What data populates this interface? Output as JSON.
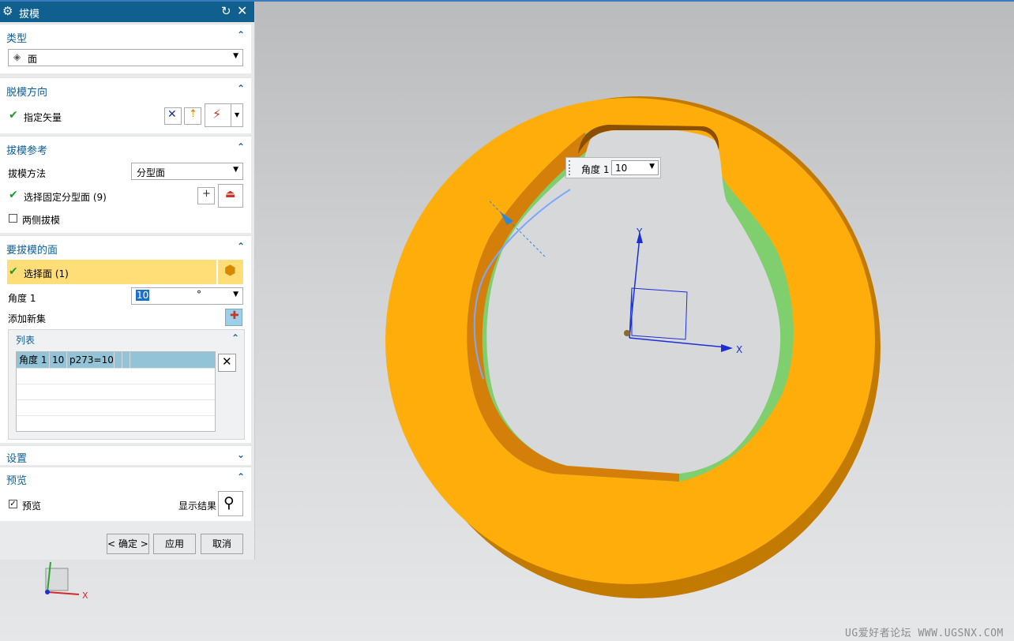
{
  "dialog": {
    "title": "拔模",
    "type_section": {
      "header": "类型",
      "type_value": "面"
    },
    "draw_direction_section": {
      "header": "脱模方向",
      "specify_vector_label": "指定矢量"
    },
    "draft_reference_section": {
      "header": "拔模参考",
      "method_label": "拔模方法",
      "method_value": "分型面",
      "select_parting_label": "选择固定分型面 (9)",
      "both_sides_label": "两侧拔模"
    },
    "faces_section": {
      "header": "要拔模的面",
      "select_face_label": "选择面 (1)",
      "angle_label": "角度 1",
      "angle_value": "10",
      "angle_unit": "°",
      "add_new_set_label": "添加新集"
    },
    "list_section": {
      "header": "列表",
      "rows": [
        {
          "name": "角度 1",
          "value": "10",
          "expr": "p273=10"
        }
      ]
    },
    "settings_section": {
      "header": "设置"
    },
    "preview_section": {
      "header": "预览",
      "preview_label": "预览",
      "show_result_label": "显示结果"
    },
    "buttons": {
      "ok": "< 确定 >",
      "apply": "应用",
      "cancel": "取消"
    }
  },
  "viewport": {
    "angle_popup": {
      "label": "角度 1",
      "value": "10"
    },
    "axis_labels": {
      "x": "X",
      "y": "Y",
      "triad_x": "X"
    },
    "watermark": "UG爱好者论坛 WWW.UGSNX.COM",
    "colors": {
      "part_face": "#ffad0a",
      "part_side": "#c27a00",
      "drafted_face": "#7fcf6f",
      "selection_blue": "#1c2fd6",
      "title_bar": "#0f5f8f"
    }
  }
}
